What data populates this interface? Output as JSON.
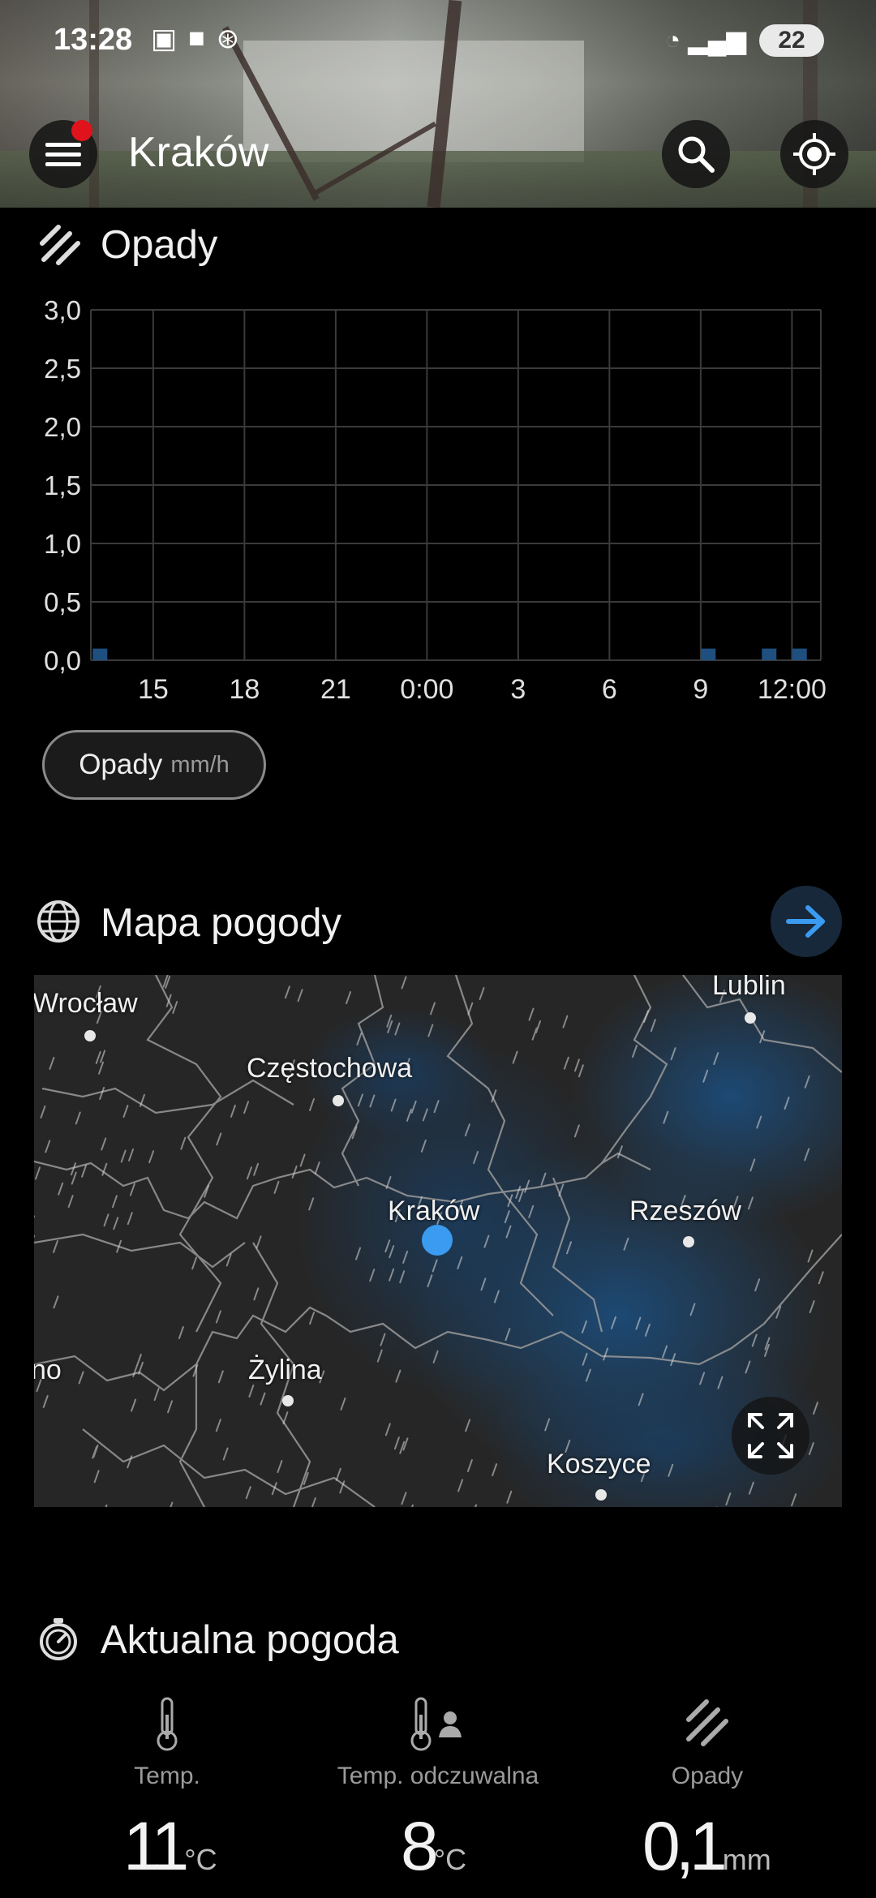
{
  "status_bar": {
    "time": "13:28",
    "battery": "22"
  },
  "header": {
    "city": "Kraków",
    "menu_icon": "hamburger-menu-icon",
    "search_icon": "search-icon",
    "location_icon": "locate-icon"
  },
  "precipitation": {
    "title": "Opady",
    "chip_label": "Opady",
    "chip_unit": "mm/h"
  },
  "chart_data": {
    "type": "bar",
    "x_tick_labels": [
      "15",
      "18",
      "21",
      "0:00",
      "3",
      "6",
      "9",
      "12:00"
    ],
    "y_tick_labels": [
      "0,0",
      "0,5",
      "1,0",
      "1,5",
      "2,0",
      "2,5",
      "3,0"
    ],
    "ylim": [
      0,
      3.0
    ],
    "bar_color": "#1f4f7f",
    "bars": [
      {
        "hour_offset": 0.5,
        "value": 0.1
      },
      {
        "hour_offset": 20.5,
        "value": 0.1
      },
      {
        "hour_offset": 22.5,
        "value": 0.1
      },
      {
        "hour_offset": 23.5,
        "value": 0.1
      }
    ],
    "grid": true
  },
  "weather_map": {
    "title": "Mapa pogody",
    "cities": [
      "Wrocław",
      "Lublin",
      "Częstochowa",
      "Kraków",
      "Rzeszów",
      "no",
      "Żylina",
      "Koszyce"
    ]
  },
  "current_weather": {
    "title": "Aktualna pogoda",
    "items": [
      {
        "label": "Temp.",
        "value": "11",
        "unit": "°C"
      },
      {
        "label": "Temp. odczuwalna",
        "value": "8",
        "unit": "°C"
      },
      {
        "label": "Opady",
        "value": "0,1",
        "unit": "mm"
      }
    ]
  }
}
